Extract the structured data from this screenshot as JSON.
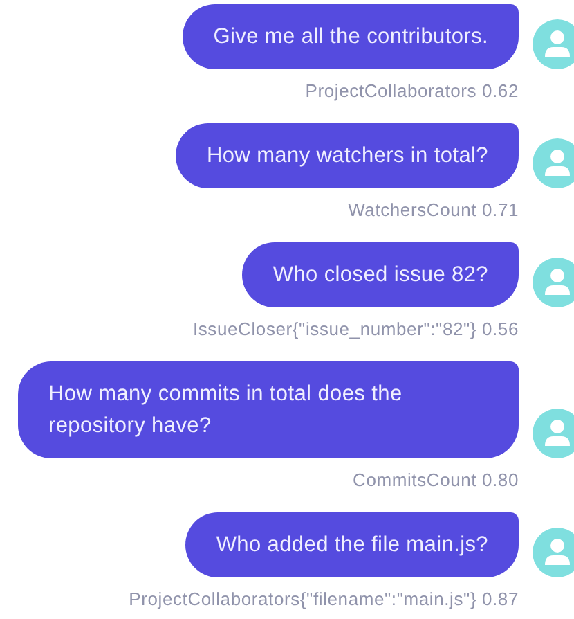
{
  "messages": [
    {
      "text": "Give me all the contributors.",
      "caption": "ProjectCollaborators 0.62"
    },
    {
      "text": "How many watchers in total?",
      "caption": "WatchersCount 0.71"
    },
    {
      "text": "Who closed issue 82?",
      "caption": "IssueCloser{\"issue_number\":\"82\"} 0.56"
    },
    {
      "text": "How many commits in total does the repository have?",
      "caption": "CommitsCount 0.80"
    },
    {
      "text": "Who added the file main.js?",
      "caption": "ProjectCollaborators{\"filename\":\"main.js\"} 0.87"
    }
  ]
}
